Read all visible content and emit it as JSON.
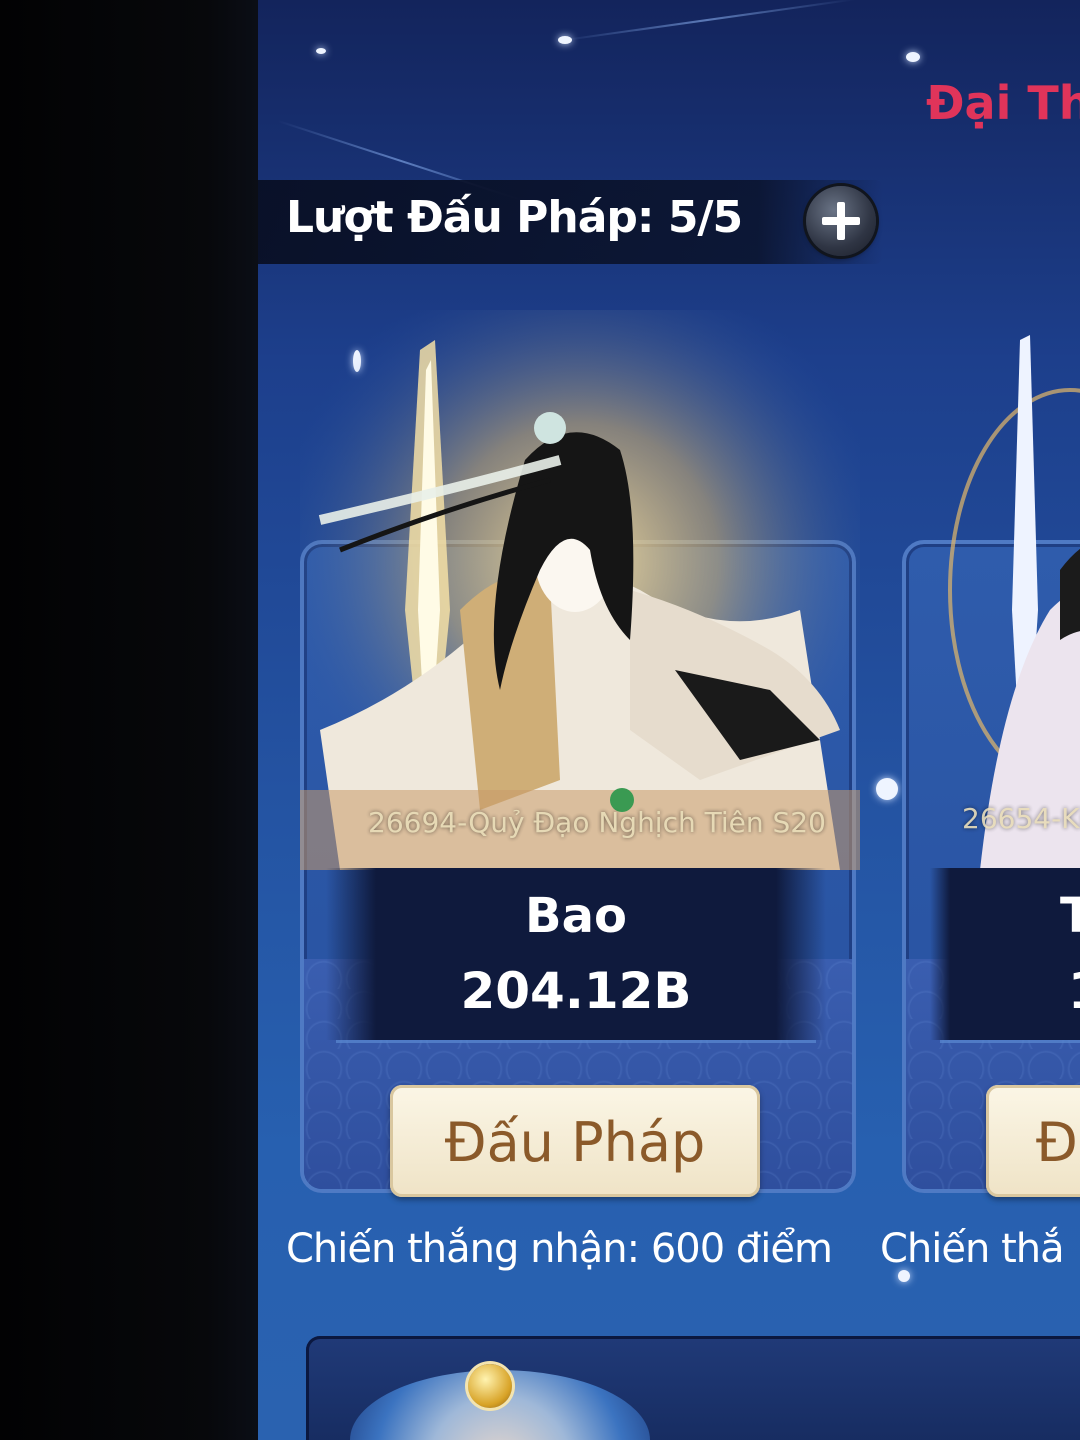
{
  "header": {
    "title_partial": "Đại Th"
  },
  "turns": {
    "label": "Lượt Đấu Pháp: 5/5",
    "add_icon": "plus-icon"
  },
  "opponents": [
    {
      "server": "26694-Quỷ Đạo Nghịch Tiên S20",
      "name": "Bao",
      "power": "204.12B",
      "fight_label": "Đấu Pháp",
      "reward": "Chiến thắng nhận: 600 điểm"
    },
    {
      "server": "26654-Ki",
      "name": "T",
      "power": "1",
      "fight_label": "Đ",
      "reward": "Chiến thắ"
    }
  ],
  "colors": {
    "accent_title": "#e0345a",
    "button_bg": "#fbf6e6",
    "button_text": "#8b5a2a",
    "panel_dark": "#0f1a3d",
    "screen_blue": "#2453a2"
  }
}
